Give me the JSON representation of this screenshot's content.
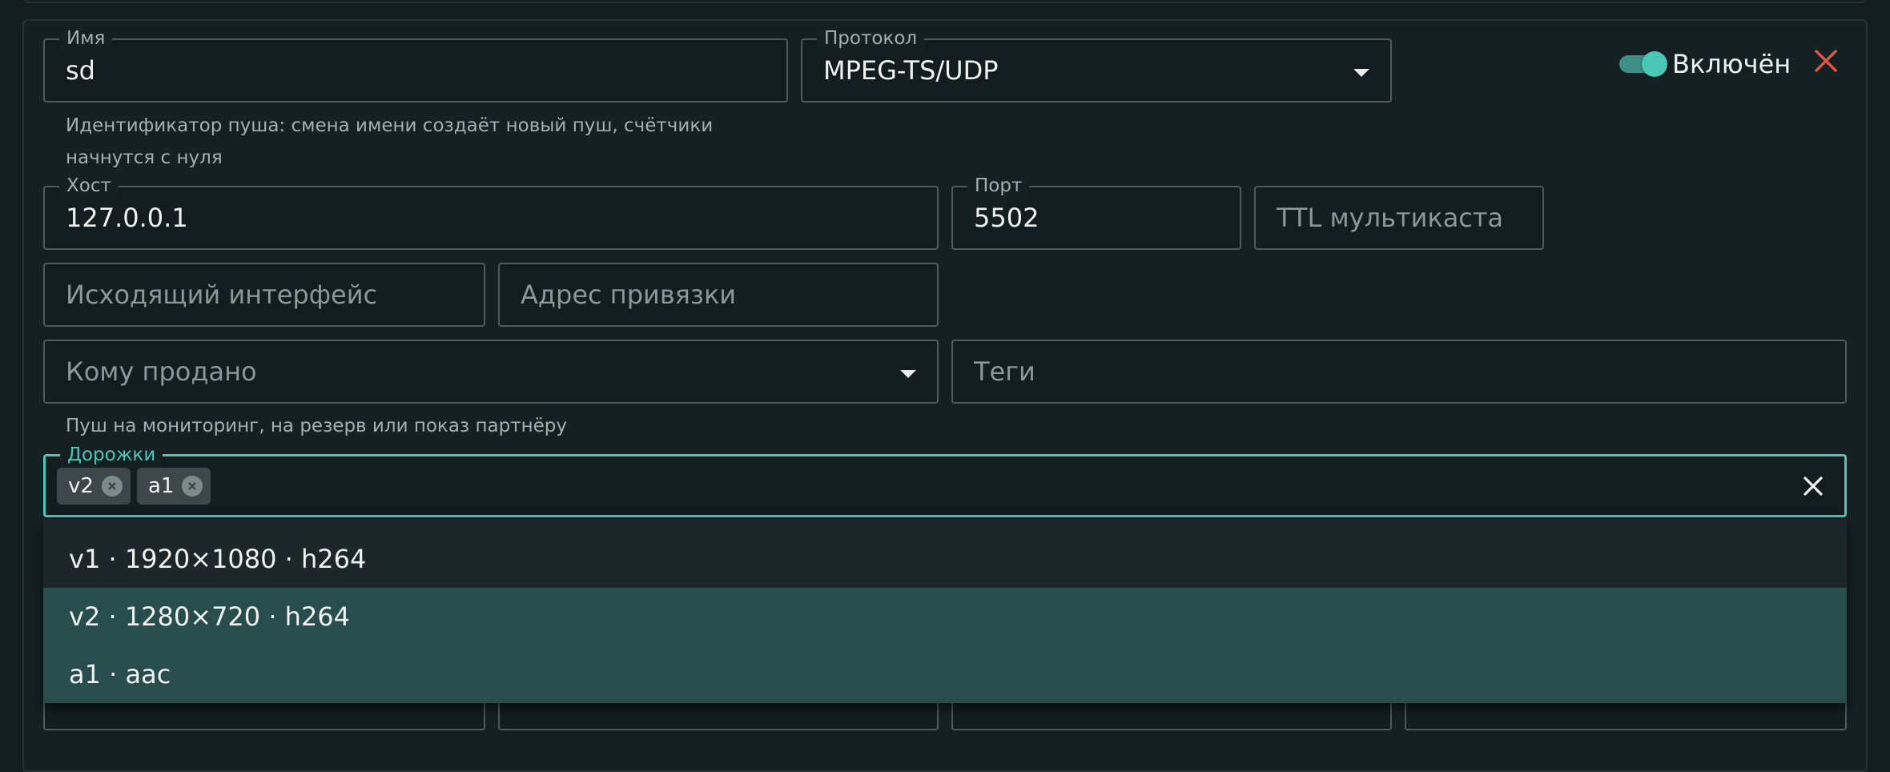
{
  "form": {
    "name_label": "Имя",
    "name_value": "sd",
    "name_helper_line1": "Идентификатор пуша: смена имени создаёт новый пуш, счётчики",
    "name_helper_line2": "начнутся с нуля",
    "protocol_label": "Протокол",
    "protocol_value": "MPEG-TS/UDP",
    "enabled_label": "Включён",
    "enabled": true,
    "host_label": "Хост",
    "host_value": "127.0.0.1",
    "port_label": "Порт",
    "port_value": "5502",
    "ttl_placeholder": "TTL мультикаста",
    "out_iface_placeholder": "Исходящий интерфейс",
    "bind_addr_placeholder": "Адрес привязки",
    "sold_to_placeholder": "Кому продано",
    "sold_to_helper": "Пуш на мониторинг, на резерв или показ партнёру",
    "tags_placeholder": "Теги",
    "tracks_label": "Дорожки",
    "tracks_selected": [
      "v2",
      "a1"
    ]
  },
  "tracks_menu": {
    "options": [
      {
        "label": "v1 · 1920×1080 · h264",
        "selected": false
      },
      {
        "label": "v2 · 1280×720 · h264",
        "selected": true
      },
      {
        "label": "a1 · aac",
        "selected": true
      }
    ]
  },
  "colors": {
    "accent": "#4bc7b7",
    "danger": "#e0554a",
    "option_selected_bg": "#294c4d"
  },
  "icons": {
    "protocol_select": "chevron-down-icon",
    "sold_to_select": "chevron-down-icon",
    "remove_push": "close-icon",
    "clear_tracks": "close-icon",
    "chip_remove": "cancel-circle-icon"
  }
}
